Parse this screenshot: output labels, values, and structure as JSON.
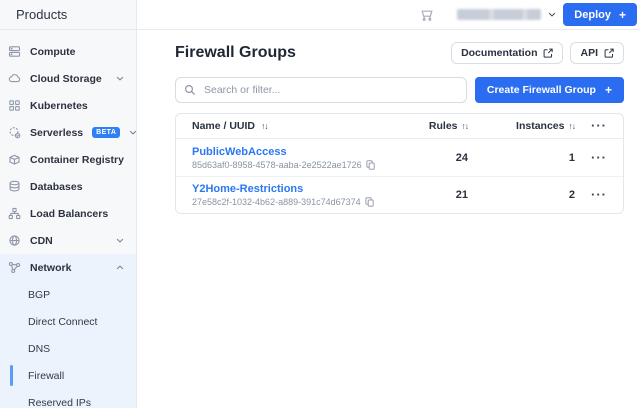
{
  "sidebar": {
    "title": "Products",
    "items": [
      {
        "label": "Compute"
      },
      {
        "label": "Cloud Storage",
        "chevron": "down"
      },
      {
        "label": "Kubernetes"
      },
      {
        "label": "Serverless",
        "badge": "BETA",
        "chevron": "down"
      },
      {
        "label": "Container Registry"
      },
      {
        "label": "Databases"
      },
      {
        "label": "Load Balancers"
      },
      {
        "label": "CDN",
        "chevron": "down"
      },
      {
        "label": "Network",
        "chevron": "up",
        "expanded": true
      }
    ],
    "network_subitems": [
      {
        "label": "BGP"
      },
      {
        "label": "Direct Connect"
      },
      {
        "label": "DNS"
      },
      {
        "label": "Firewall",
        "active": true
      },
      {
        "label": "Reserved IPs"
      }
    ]
  },
  "topbar": {
    "deploy_label": "Deploy"
  },
  "main": {
    "title": "Firewall Groups",
    "documentation_button": "Documentation",
    "api_button": "API",
    "search_placeholder": "Search or filter...",
    "create_button": "Create Firewall Group",
    "table": {
      "columns": [
        "Name / UUID",
        "Rules",
        "Instances"
      ],
      "rows": [
        {
          "name": "PublicWebAccess",
          "uuid": "85d63af0-8958-4578-aaba-2e2522ae1726",
          "rules": "24",
          "instances": "1"
        },
        {
          "name": "Y2Home-Restrictions",
          "uuid": "27e58c2f-1032-4b62-a889-391c74d67374",
          "rules": "21",
          "instances": "2"
        }
      ]
    }
  },
  "icons": {
    "plus": "+",
    "sort": "↑↓",
    "ellipsis": "···"
  },
  "colors": {
    "accent": "#2a6df0",
    "link": "#2b78f2",
    "active_indicator": "#5b9cf6",
    "beta_badge": "#2f80f2",
    "sidebar_bg": "#f7f8fa",
    "network_section_bg": "#edf3fc"
  }
}
